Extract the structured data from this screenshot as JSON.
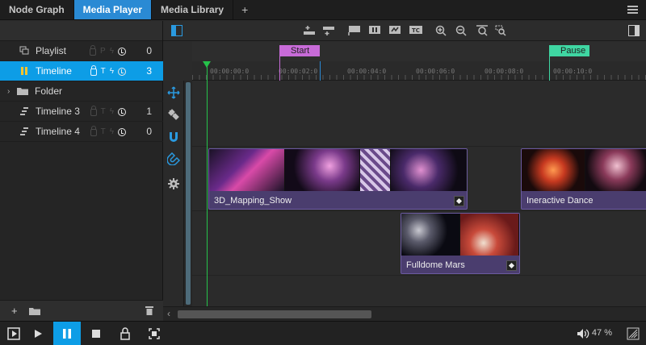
{
  "tabs": [
    {
      "label": "Node Graph",
      "active": false
    },
    {
      "label": "Media Player",
      "active": true
    },
    {
      "label": "Media Library",
      "active": false
    }
  ],
  "tab_add_label": "+",
  "tree": {
    "items": [
      {
        "label": "Playlist",
        "count": "0",
        "flag_p": "P",
        "selected": false
      },
      {
        "label": "Timeline",
        "count": "3",
        "flag_t": "T",
        "selected": true
      },
      {
        "label": "Folder"
      },
      {
        "label": "Timeline 3",
        "count": "1",
        "flag_t": "T"
      },
      {
        "label": "Timeline 4",
        "count": "0",
        "flag_t": "T"
      }
    ]
  },
  "markers": [
    {
      "label": "Start",
      "color": "#c86bd8"
    },
    {
      "label": "Pause",
      "color": "#3fd6a2"
    }
  ],
  "ruler": {
    "labels": [
      "00:00:00:0",
      "00:00:02:0",
      "00:00:04:0",
      "00:00:06:0",
      "00:00:08:0",
      "00:00:10:0"
    ]
  },
  "clips": [
    {
      "label": "3D_Mapping_Show"
    },
    {
      "label": "Ineractive Dance"
    },
    {
      "label": "Fulldome Mars"
    }
  ],
  "footer": {
    "volume_label": "47 %"
  },
  "colors": {
    "accent": "#0d9de6",
    "clip": "#4a3d6e",
    "playhead": "#25c24a"
  }
}
